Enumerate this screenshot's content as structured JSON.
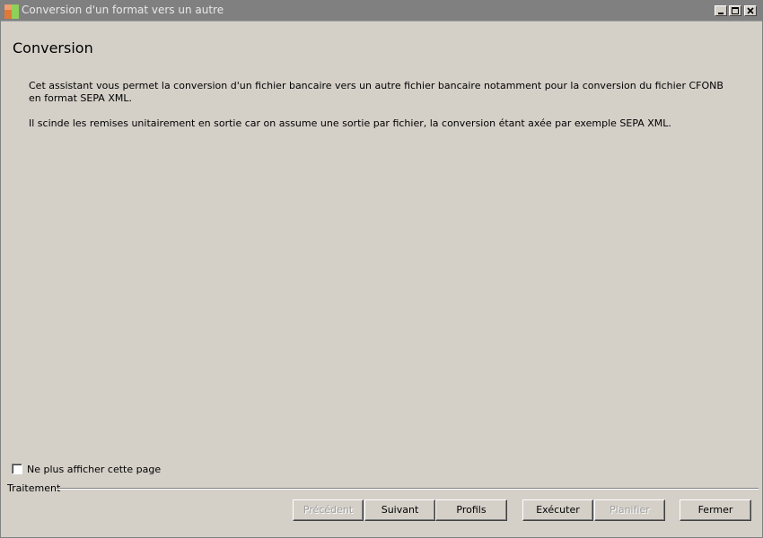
{
  "window": {
    "title": "Conversion d'un format vers un autre"
  },
  "icons": {
    "app": "app-icon",
    "minimize": "minimize-icon",
    "maximize": "maximize-icon",
    "close": "close-icon"
  },
  "page": {
    "title": "Conversion",
    "paragraphs": [
      "Cet assistant vous permet la conversion d'un fichier bancaire vers un autre fichier bancaire notamment pour la conversion du fichier CFONB en format SEPA XML.",
      "Il scinde les remises unitairement en sortie car on assume une sortie par fichier, la conversion étant axée par exemple SEPA XML."
    ]
  },
  "options": {
    "dont_show_label": "Ne plus afficher cette page",
    "dont_show_checked": false
  },
  "group": {
    "label": "Traitement"
  },
  "buttons": {
    "previous": "Précédent",
    "next": "Suivant",
    "profiles": "Profils",
    "execute": "Exécuter",
    "schedule": "Planifier",
    "close": "Fermer"
  },
  "colors": {
    "window_bg": "#d4d0c8",
    "titlebar_inactive": "#808080",
    "disabled_text": "#a0a0a0"
  }
}
